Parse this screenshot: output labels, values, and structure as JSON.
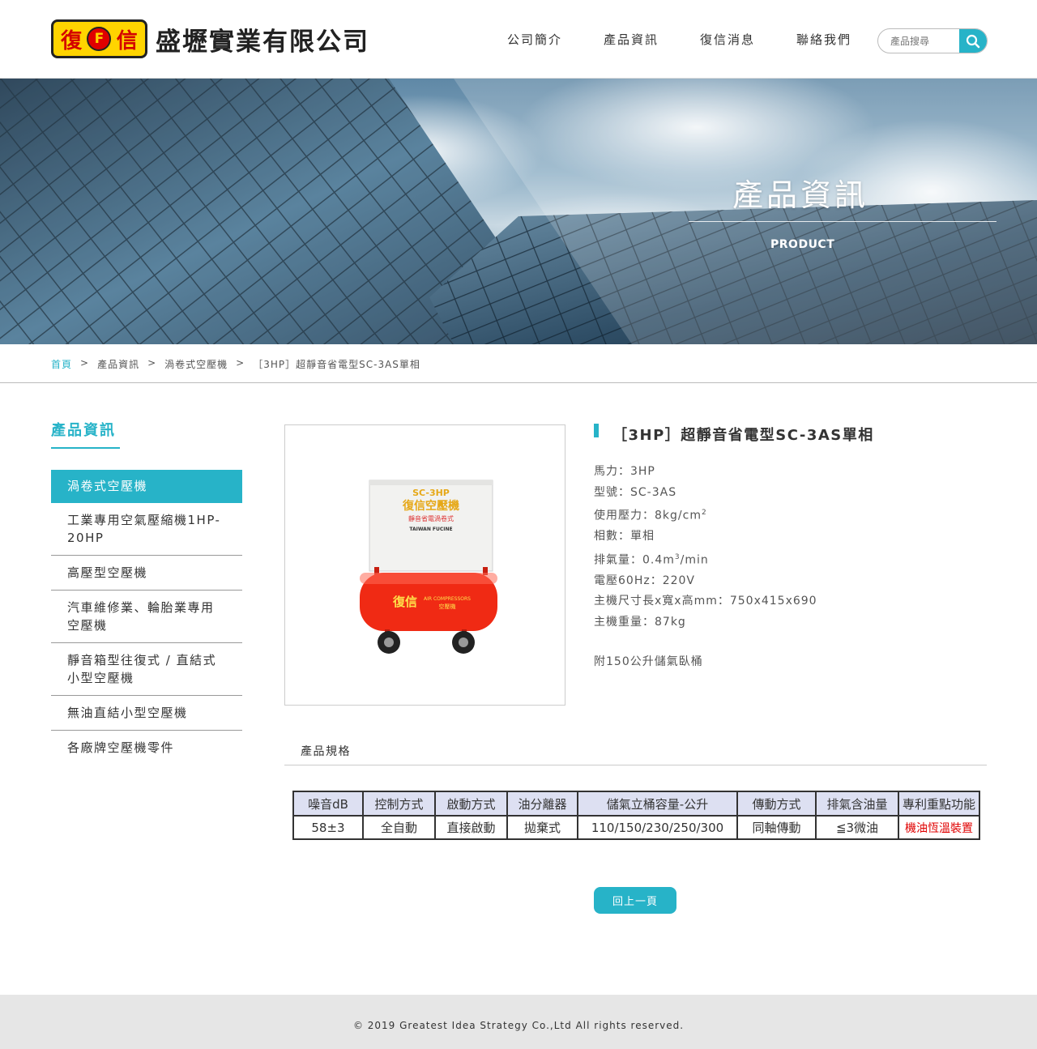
{
  "header": {
    "company_name": "盛壢實業有限公司",
    "logo_chars": [
      "復",
      "F",
      "信"
    ],
    "nav": [
      "公司簡介",
      "產品資訊",
      "復信消息",
      "聯絡我們"
    ],
    "search_placeholder": "產品搜尋"
  },
  "banner": {
    "title": "產品資訊",
    "subtitle": "PRODUCT"
  },
  "breadcrumb": [
    "首頁",
    "產品資訊",
    "渦卷式空壓機",
    "［3HP］超靜音省電型SC-3AS單相"
  ],
  "breadcrumb_sep": ">",
  "sidebar": {
    "title": "產品資訊",
    "items": [
      "渦卷式空壓機",
      "工業專用空氣壓縮機1HP-20HP",
      "高壓型空壓機",
      "汽車維修業、輪胎業專用空壓機",
      "靜音箱型往復式 / 直結式小型空壓機",
      "無油直結小型空壓機",
      "各廠牌空壓機零件"
    ]
  },
  "product": {
    "title": "［3HP］超靜音省電型SC-3AS單相",
    "image_text": {
      "model": "SC-3HP",
      "name": "復信空壓機",
      "tag": "靜音省電渦卷式",
      "brand_en": "TAIWAN FUCINE",
      "tank_brand": "復信",
      "tank_en": "AIR COMPRESSORS",
      "tank_cn": "空壓機"
    },
    "specs": {
      "power": "馬力：3HP",
      "model": "型號：SC-3AS",
      "pressure": "使用壓力：8kg/cm",
      "pressure_sup": "2",
      "phase": "相數：單相",
      "displacement": "排氣量：0.4m",
      "displacement_sup": "3",
      "displacement_unit": "/min",
      "voltage": "電壓60Hz：220V",
      "dimensions": "主機尺寸長x寬x高mm：750x415x690",
      "weight": "主機重量：87kg",
      "extra": "附150公升儲氣臥桶"
    },
    "spec_tab": "產品規格",
    "spec_table": {
      "headers": [
        "噪音dB",
        "控制方式",
        "啟動方式",
        "油分離器",
        "儲氣立桶容量-公升",
        "傳動方式",
        "排氣含油量",
        "專利重點功能"
      ],
      "values": [
        "58±3",
        "全自動",
        "直接啟動",
        "拋棄式",
        "110/150/230/250/300",
        "同軸傳動",
        "≦3微油",
        "機油恆溫裝置"
      ],
      "highlight_color": "#e00000"
    },
    "back_button": "回上一頁"
  },
  "footer": {
    "copyright": "© 2019 Greatest Idea Strategy Co.,Ltd All rights reserved."
  },
  "colors": {
    "accent": "#27b3c8",
    "tank_red": "#f02a14",
    "logo_yellow": "#ffd400"
  }
}
